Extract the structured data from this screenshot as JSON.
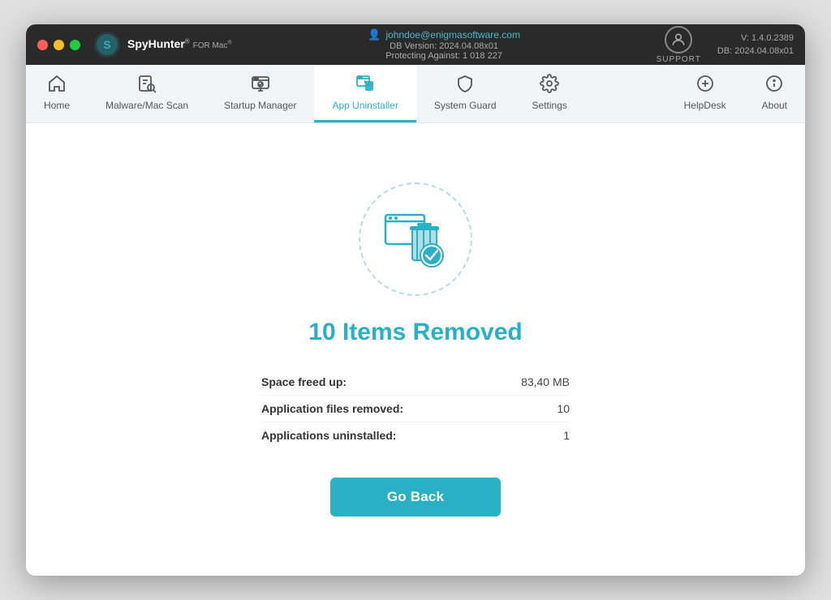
{
  "window": {
    "title": "SpyHunter for Mac"
  },
  "titlebar": {
    "logo_text": "SpyHunter",
    "logo_for_mac": "FOR Mac®",
    "user_email": "johndoe@enigmasoftware.com",
    "db_version": "DB Version: 2024.04.08x01",
    "protecting_against": "Protecting Against: 1 018 227",
    "support_label": "SUPPORT",
    "version": "V: 1.4.0.2389",
    "db_label": "DB:  2024.04.08x01"
  },
  "navbar": {
    "items": [
      {
        "id": "home",
        "label": "Home",
        "icon": "🏠"
      },
      {
        "id": "malware-scan",
        "label": "Malware/Mac Scan",
        "icon": "🔍"
      },
      {
        "id": "startup-manager",
        "label": "Startup Manager",
        "icon": "⚙"
      },
      {
        "id": "app-uninstaller",
        "label": "App Uninstaller",
        "icon": "🗑"
      },
      {
        "id": "system-guard",
        "label": "System Guard",
        "icon": "🛡"
      },
      {
        "id": "settings",
        "label": "Settings",
        "icon": "⚙"
      }
    ],
    "right_items": [
      {
        "id": "helpdesk",
        "label": "HelpDesk",
        "icon": "➕"
      },
      {
        "id": "about",
        "label": "About",
        "icon": "ℹ"
      }
    ]
  },
  "result": {
    "title": "10 Items Removed",
    "stats": [
      {
        "label": "Space freed up:",
        "value": "83,40 MB"
      },
      {
        "label": "Application files removed:",
        "value": "10"
      },
      {
        "label": "Applications uninstalled:",
        "value": "1"
      }
    ],
    "button_label": "Go Back"
  }
}
